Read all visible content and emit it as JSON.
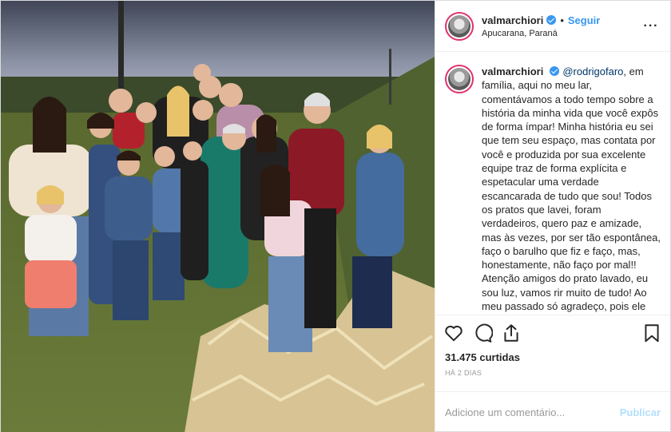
{
  "post": {
    "username": "valmarchiori",
    "follow_label": "Seguir",
    "dot": "•",
    "location": "Apucarana, Paraná",
    "more_label": "···"
  },
  "caption": {
    "username": "valmarchiori",
    "mention": "@rodrigofaro",
    "text": ", em família, aqui no meu lar, comentávamos a todo tempo sobre a história da minha vida que você expôs de forma ímpar! Minha história eu sei que tem seu espaço, mas contata por você e produzida por sua excelente equipe traz de forma explícita e espetacular uma verdade escancarada de tudo que sou! Todos os pratos que lavei, foram verdadeiros, quero paz e amizade, mas às vezes, por ser tão espontânea, faço o barulho que fiz e faço, mas, honestamente, não faço por mal!! Atenção amigos do prato lavado, eu sou luz, vamos rir muito de tudo! Ao meu passado só agradeço, pois ele me fortaleceu! Mãezinha, Paizinho vocês fizeram o melhor de vocês! EU SOU GRATA!!! Hello, olha"
  },
  "stats": {
    "likes": "31.475 curtidas",
    "time": "HÁ 2 DIAS"
  },
  "comment": {
    "placeholder": "Adicione um comentário...",
    "publish_label": "Publicar"
  },
  "icons": [
    "heart-icon",
    "comment-icon",
    "share-icon",
    "bookmark-icon",
    "verified-icon"
  ],
  "colors": {
    "accent": "#3897f0",
    "publish_disabled": "#b2dffc",
    "muted": "#999999",
    "border": "#dbdbdb"
  }
}
